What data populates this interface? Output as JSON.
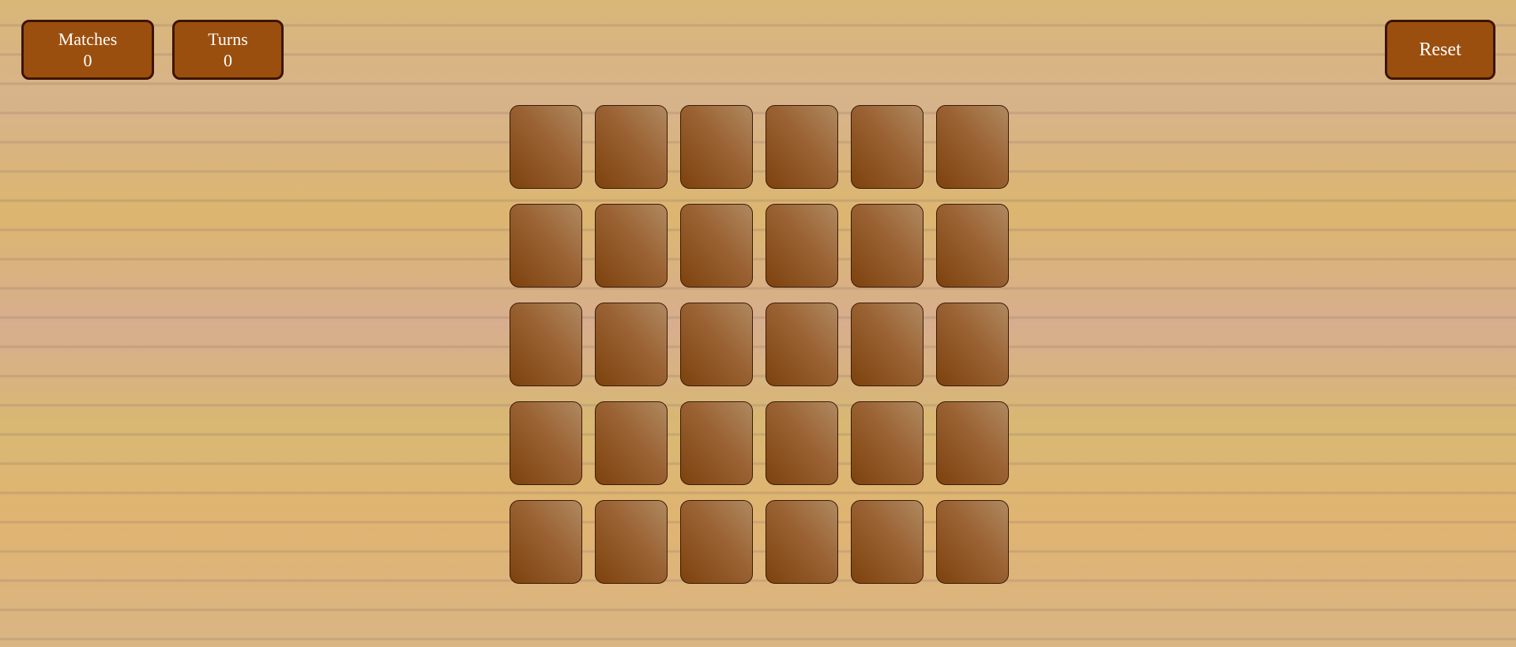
{
  "stats": {
    "matches": {
      "label": "Matches",
      "value": "0"
    },
    "turns": {
      "label": "Turns",
      "value": "0"
    }
  },
  "controls": {
    "reset_label": "Reset"
  },
  "board": {
    "rows": 5,
    "columns": 6,
    "cards_face_down": 30
  },
  "colors": {
    "button_fill": "#9b4f0e",
    "button_border": "#3c1406",
    "card_back_light": "#b08960",
    "card_back_dark": "#7d420d",
    "background": "#ddb57e"
  }
}
